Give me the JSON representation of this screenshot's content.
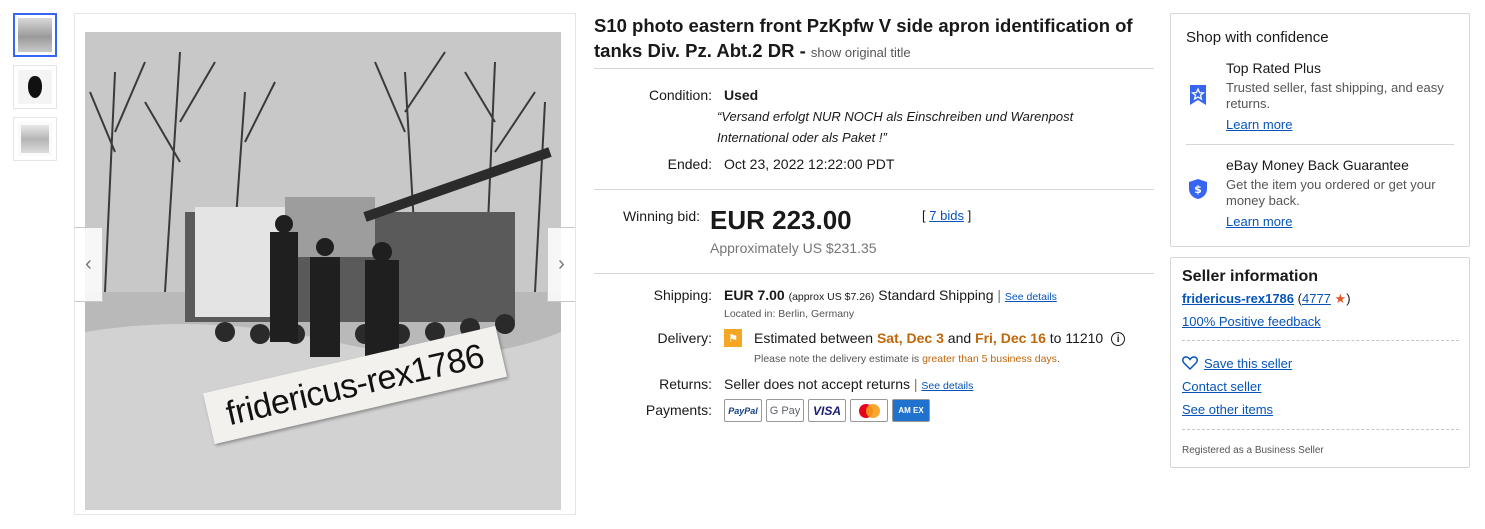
{
  "title": "S10 photo eastern front PzKpfw V side apron identification of tanks Div. Pz. Abt.2 DR",
  "title_separator": "-",
  "show_original_title": "show original title",
  "watermark": "fridericus-rex1786",
  "thumbnails": [
    "thumbnail-1",
    "thumbnail-2",
    "thumbnail-3"
  ],
  "condition": {
    "label": "Condition:",
    "value": "Used",
    "quote_open": "“",
    "quote": "“Versand erfolgt NUR NOCH als Einschreiben und Warenpost International oder als Paket !”",
    "quote_close": "”"
  },
  "ended": {
    "label": "Ended:",
    "value": "Oct 23, 2022 12:22:00 PDT"
  },
  "winning_bid": {
    "label": "Winning bid:",
    "price": "EUR 223.00",
    "bids_open": "[",
    "bids": "7 bids",
    "bids_close": "]",
    "approx": "Approximately US $231.35"
  },
  "shipping": {
    "label": "Shipping:",
    "price": "EUR 7.00",
    "approx": "(approx US $7.26)",
    "service": "Standard Shipping",
    "divider": "|",
    "details_link": "See details",
    "location": "Located in: Berlin, Germany"
  },
  "delivery": {
    "label": "Delivery:",
    "prefix": "Estimated between",
    "date1": "Sat, Dec 3",
    "and": "and",
    "date2": "Fri, Dec 16",
    "to": "to 11210",
    "info_icon": "i",
    "note_prefix": "Please note the delivery estimate is",
    "note_highlight": "greater than 5 business days",
    "note_suffix": "."
  },
  "returns": {
    "label": "Returns:",
    "value": "Seller does not accept returns",
    "divider": "|",
    "details_link": "See details"
  },
  "payments": {
    "label": "Payments:",
    "methods": [
      {
        "name": "PayPal",
        "icon": "paypal-icon"
      },
      {
        "name": "G Pay",
        "icon": "google-pay-icon"
      },
      {
        "name": "VISA",
        "icon": "visa-icon"
      },
      {
        "name": "",
        "icon": "mastercard-icon"
      },
      {
        "name": "AM EX",
        "icon": "amex-icon"
      }
    ]
  },
  "shop_confidence": {
    "heading": "Shop with confidence",
    "items": [
      {
        "title": "Top Rated Plus",
        "desc": "Trusted seller, fast shipping, and easy returns.",
        "link": "Learn more",
        "icon": "top-rated-badge-icon"
      },
      {
        "title": "eBay Money Back Guarantee",
        "desc": "Get the item you ordered or get your money back.",
        "link": "Learn more",
        "icon": "shield-dollar-icon"
      }
    ]
  },
  "seller": {
    "heading": "Seller information",
    "name": "fridericus-rex1786",
    "score_open": "(",
    "score": "4777",
    "score_close": ")",
    "star_icon": "★",
    "feedback": "100% Positive feedback",
    "save": "Save this seller",
    "contact": "Contact seller",
    "other_items": "See other items",
    "registered": "Registered as a Business Seller"
  },
  "colors": {
    "link": "#0654ba",
    "accent_blue": "#3665f3",
    "delivery_highlight": "#c0660b",
    "star": "#e0592a"
  }
}
